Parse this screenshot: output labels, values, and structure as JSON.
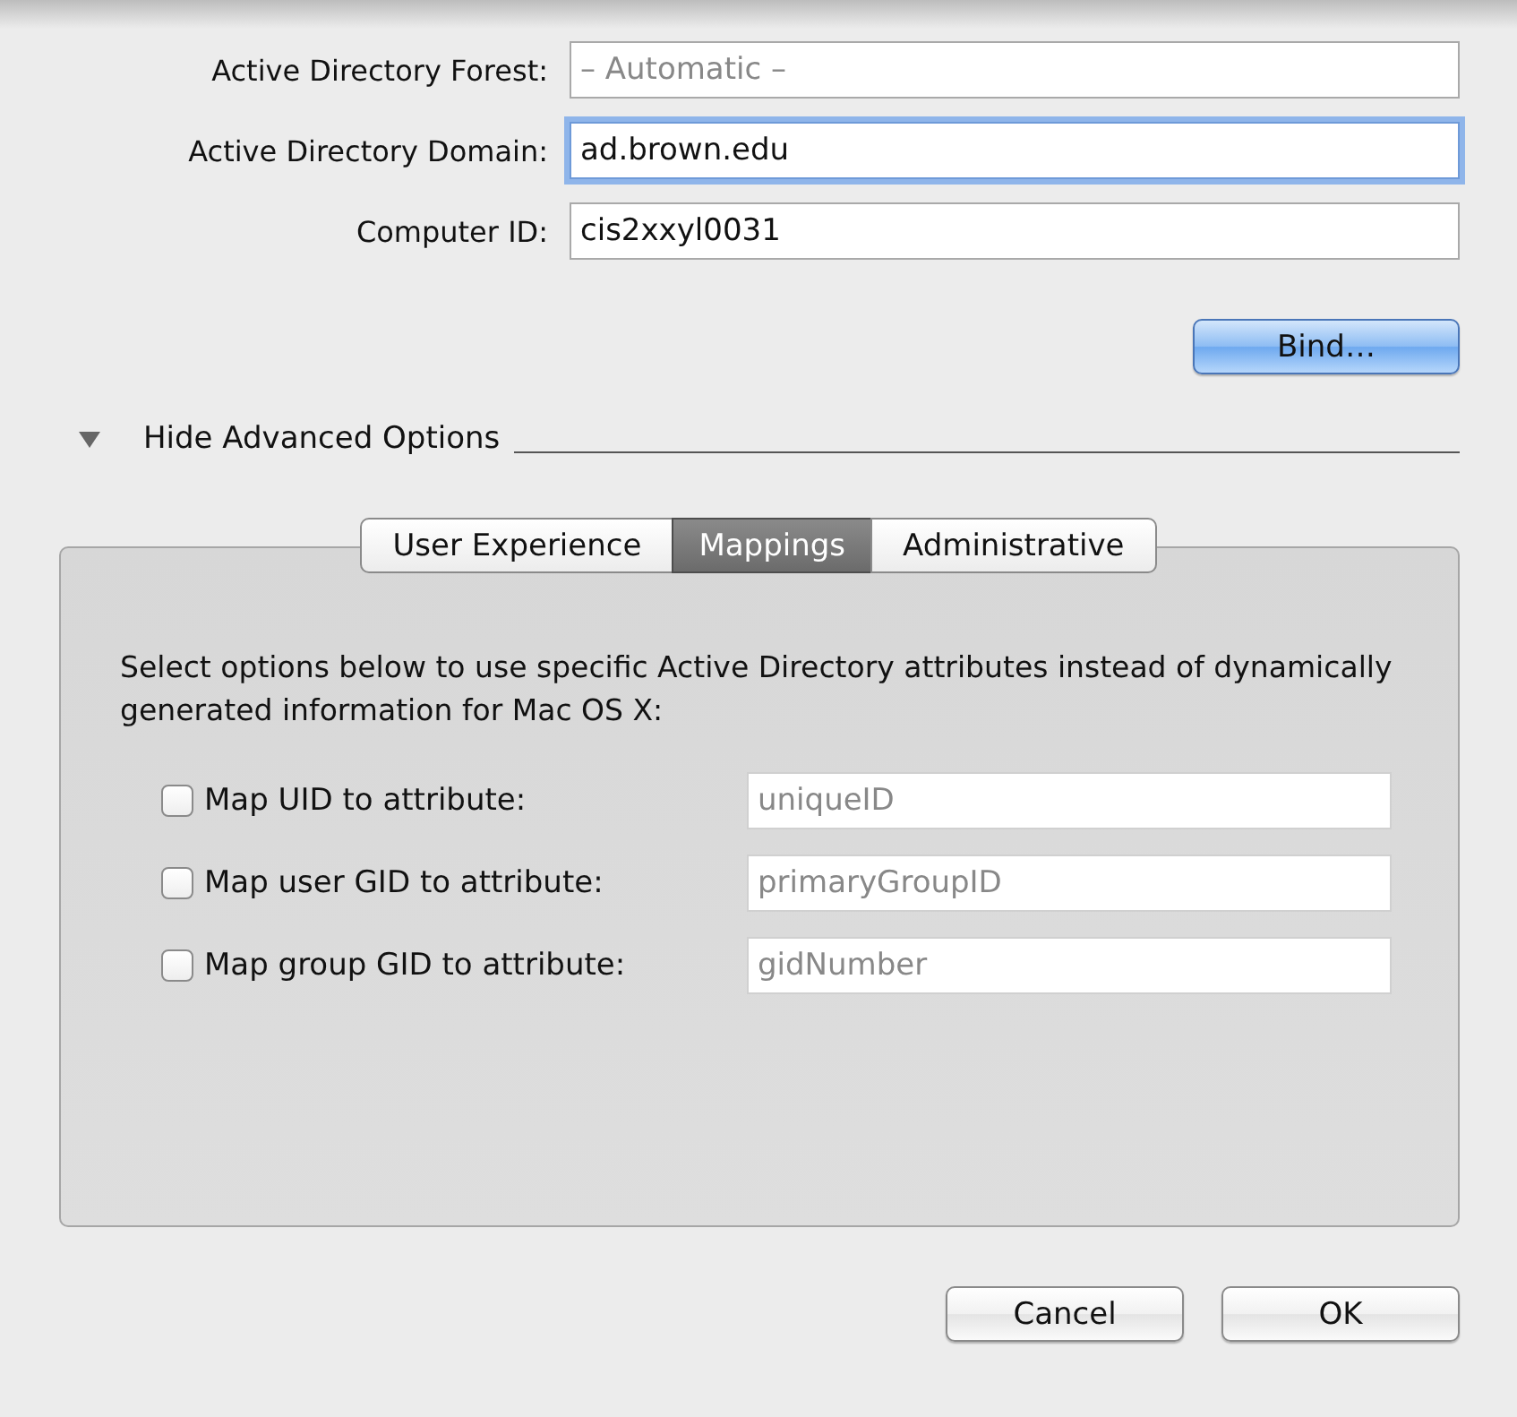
{
  "fields": [
    {
      "label": "Active Directory Forest:",
      "placeholder": "– Automatic –",
      "focused": false
    },
    {
      "label": "Active Directory Domain:",
      "value": "ad.brown.edu",
      "focused": true
    },
    {
      "label": "Computer ID:",
      "value": "cis2xxyl0031",
      "focused": false
    }
  ],
  "bind_button": "Bind…",
  "disclosure": {
    "label": "Hide Advanced Options",
    "expanded": true
  },
  "tabs": [
    {
      "label": "User Experience",
      "selected": false
    },
    {
      "label": "Mappings",
      "selected": true
    },
    {
      "label": "Administrative",
      "selected": false
    }
  ],
  "description": "Select options below to use specific Active Directory attributes instead of dynamically generated information for Mac OS X:",
  "mappings": [
    {
      "label": "Map UID to attribute:",
      "checked": false,
      "placeholder": "uniqueID"
    },
    {
      "label": "Map user GID to attribute:",
      "checked": false,
      "placeholder": "primaryGroupID"
    },
    {
      "label": "Map group GID to attribute:",
      "checked": false,
      "placeholder": "gidNumber"
    }
  ],
  "buttons": [
    {
      "label": "Cancel",
      "default": false
    },
    {
      "label": "OK",
      "default": false
    }
  ]
}
